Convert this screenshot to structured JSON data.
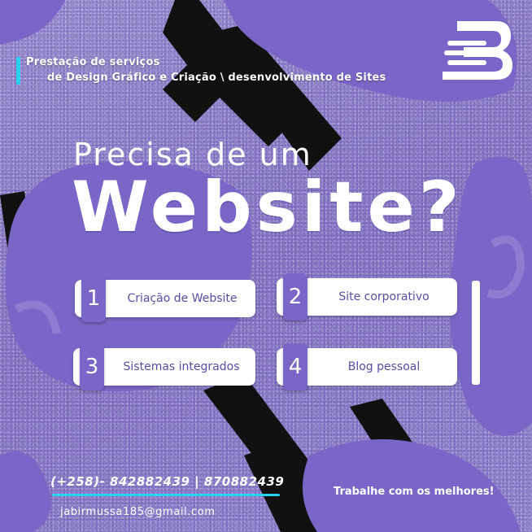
{
  "header": {
    "tagline_line1": "Prestação de serviços",
    "tagline_line2": "de Design Gráfico e Criação \\ desenvolvimento  de Sites"
  },
  "logo": {
    "icon": "stacked-b-logo-icon"
  },
  "headline": {
    "small": "Precisa de um",
    "big": "Website?"
  },
  "services": [
    {
      "number": "1",
      "label": "Criação de Website"
    },
    {
      "number": "2",
      "label": "Site corporativo"
    },
    {
      "number": "3",
      "label": "Sistemas integrados"
    },
    {
      "number": "4",
      "label": "Blog pessoal"
    }
  ],
  "contact": {
    "phone": "(+258)- 842882439 | 870882439",
    "email": "jabirmussa185@gmail.com",
    "motto": "Trabalhe com os melhores!"
  },
  "colors": {
    "background": "#8d7fc4",
    "accent": "#29d3f0",
    "blob": "#7a66c6",
    "text_service": "#5b4aa8"
  }
}
